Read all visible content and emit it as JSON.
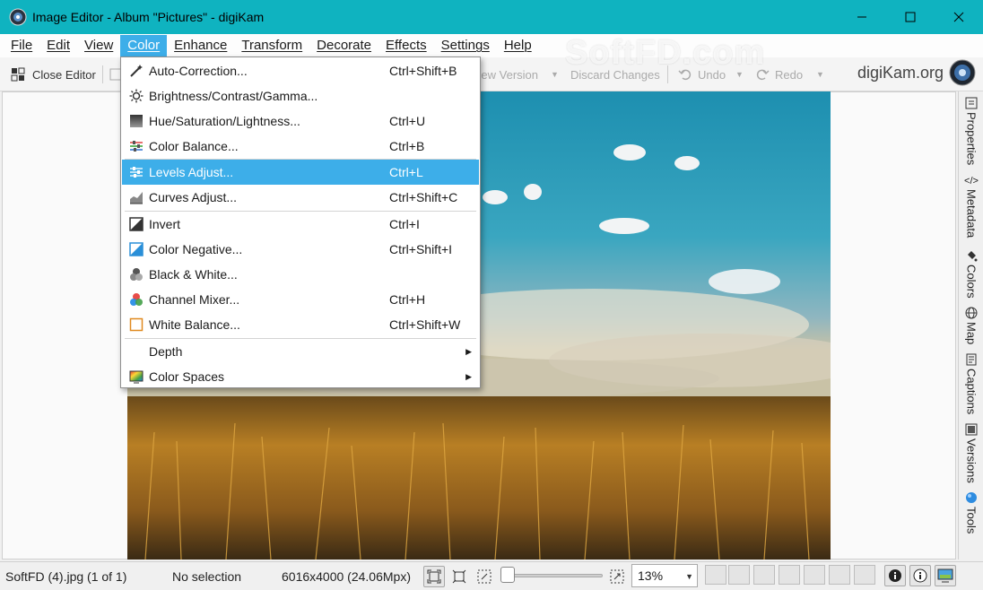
{
  "window": {
    "title": "Image Editor - Album \"Pictures\" - digiKam"
  },
  "menubar": [
    {
      "label": "File"
    },
    {
      "label": "Edit"
    },
    {
      "label": "View"
    },
    {
      "label": "Color"
    },
    {
      "label": "Enhance"
    },
    {
      "label": "Transform"
    },
    {
      "label": "Decorate"
    },
    {
      "label": "Effects"
    },
    {
      "label": "Settings"
    },
    {
      "label": "Help"
    }
  ],
  "toolbar": {
    "close_editor": "Close Editor",
    "new_version": "New Version",
    "discard_changes": "Discard Changes",
    "undo": "Undo",
    "redo": "Redo"
  },
  "watermark": "SoftFD.com",
  "brand": "digiKam.org",
  "color_menu": {
    "items": [
      {
        "label": "Auto-Correction...",
        "shortcut": "Ctrl+Shift+B",
        "icon": "magic-wand-icon"
      },
      {
        "label": "Brightness/Contrast/Gamma...",
        "shortcut": "",
        "icon": "sun-icon"
      },
      {
        "label": "Hue/Saturation/Lightness...",
        "shortcut": "Ctrl+U",
        "icon": "hue-icon"
      },
      {
        "label": "Color Balance...",
        "shortcut": "Ctrl+B",
        "icon": "balance-sliders-icon"
      },
      {
        "label": "Levels Adjust...",
        "shortcut": "Ctrl+L",
        "icon": "levels-icon"
      },
      {
        "label": "Curves Adjust...",
        "shortcut": "Ctrl+Shift+C",
        "icon": "curves-icon"
      },
      {
        "label": "Invert",
        "shortcut": "Ctrl+I",
        "icon": "invert-icon"
      },
      {
        "label": "Color Negative...",
        "shortcut": "Ctrl+Shift+I",
        "icon": "negative-icon"
      },
      {
        "label": "Black & White...",
        "shortcut": "",
        "icon": "black-white-icon"
      },
      {
        "label": "Channel Mixer...",
        "shortcut": "Ctrl+H",
        "icon": "channel-mixer-icon"
      },
      {
        "label": "White Balance...",
        "shortcut": "Ctrl+Shift+W",
        "icon": "white-balance-icon"
      },
      {
        "label": "Depth",
        "shortcut": "",
        "icon": ""
      },
      {
        "label": "Color Spaces",
        "shortcut": "",
        "icon": "color-spaces-icon"
      }
    ]
  },
  "right_tabs": [
    {
      "label": "Properties"
    },
    {
      "label": "Metadata"
    },
    {
      "label": "Colors"
    },
    {
      "label": "Map"
    },
    {
      "label": "Captions"
    },
    {
      "label": "Versions"
    },
    {
      "label": "Tools"
    }
  ],
  "statusbar": {
    "file": "SoftFD (4).jpg (1 of 1)",
    "selection": "No selection",
    "dimensions": "6016x4000 (24.06Mpx)",
    "zoom": "13%"
  },
  "colors": {
    "titlebar": "#0fb3c0",
    "menu_highlight": "#3daee9"
  }
}
